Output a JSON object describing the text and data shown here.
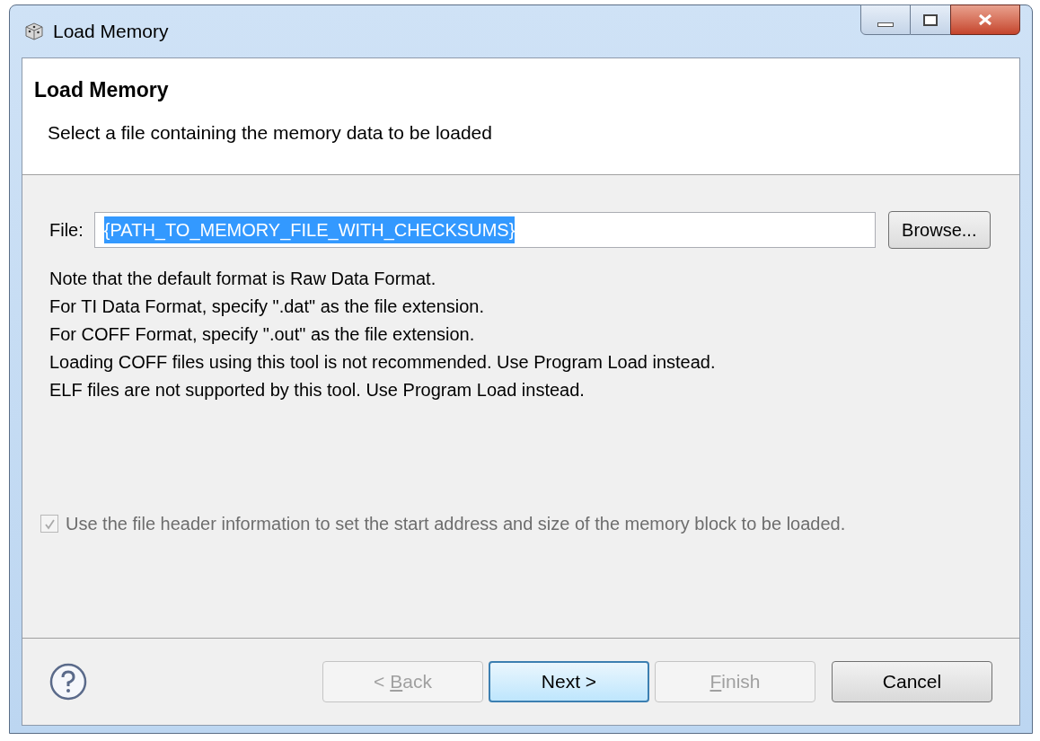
{
  "window": {
    "title": "Load Memory"
  },
  "header": {
    "title": "Load Memory",
    "description": "Select a file containing the memory data to be loaded"
  },
  "file": {
    "label": "File:",
    "value": "{PATH_TO_MEMORY_FILE_WITH_CHECKSUMS}",
    "selected": true,
    "browse": "Browse..."
  },
  "notes": [
    "Note that the default format is Raw Data Format.",
    "For TI Data Format, specify \".dat\" as the file extension.",
    "For COFF Format, specify \".out\" as the file extension.",
    "Loading COFF files using this tool is not recommended. Use Program Load instead.",
    "ELF files are not supported by this tool. Use Program Load instead."
  ],
  "checkbox": {
    "label": "Use the file header information to set the start address and size of the memory block to be loaded.",
    "checked": true,
    "disabled": true
  },
  "buttons": [
    {
      "label_parts": [
        {
          "text": "< ",
          "underlined": false
        },
        {
          "text": "B",
          "underlined": true
        },
        {
          "text": "ack",
          "underlined": false
        }
      ],
      "disabled": true,
      "default": false
    },
    {
      "label_parts": [
        {
          "text": "Next >",
          "underlined": false
        }
      ],
      "disabled": false,
      "default": true
    },
    {
      "label_parts": [
        {
          "text": "F",
          "underlined": true
        },
        {
          "text": "inish",
          "underlined": false
        }
      ],
      "disabled": true,
      "default": false
    },
    {
      "label_parts": [
        {
          "text": "Cancel",
          "underlined": false
        }
      ],
      "disabled": false,
      "default": false
    }
  ]
}
